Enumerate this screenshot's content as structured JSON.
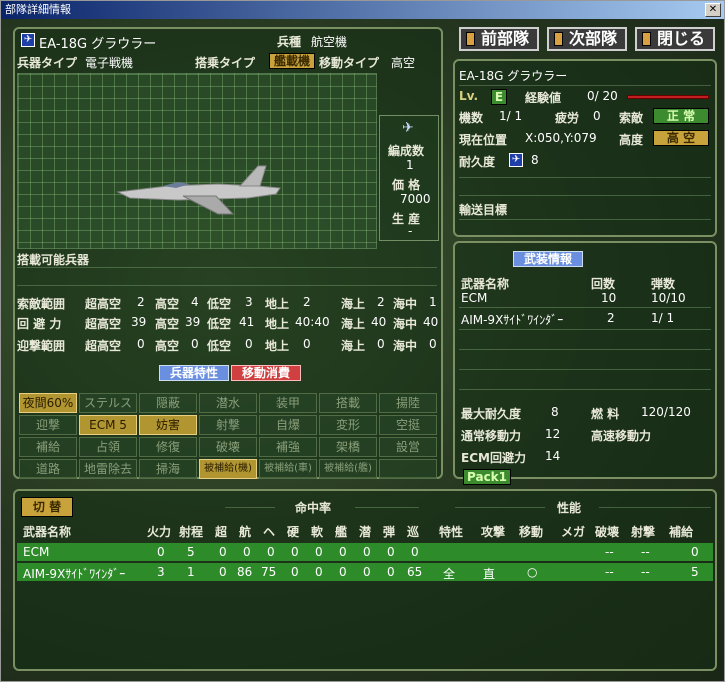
{
  "window": {
    "title": "部隊詳細情報",
    "close_label": "✕"
  },
  "left": {
    "unit_name": "EA-18G グラウラー",
    "type_label": "兵種",
    "type_value": "航空機",
    "weapon_type_label": "兵器タイプ",
    "weapon_type_value": "電子戦機",
    "carry_type_label": "搭乗タイプ",
    "carry_type_value": "艦載機",
    "move_type_label": "移動タイプ",
    "move_type_value": "高空",
    "formation_label": "編成数",
    "formation_value": "1",
    "price_label": "価 格",
    "price_value": "7000",
    "produce_label": "生 産",
    "produce_value": "-",
    "loadable_label": "搭載可能兵器",
    "ranges": [
      {
        "label": "索敵範囲",
        "vals": [
          "超高空",
          "2",
          "高空",
          "4",
          "低空",
          "3",
          "地上",
          "2",
          "海上",
          "2",
          "海中",
          "1"
        ]
      },
      {
        "label": "回 避 力",
        "vals": [
          "超高空",
          "39",
          "高空",
          "39",
          "低空",
          "41",
          "地上",
          "40:40",
          "海上",
          "40",
          "海中",
          "40"
        ]
      },
      {
        "label": "迎撃範囲",
        "vals": [
          "超高空",
          "0",
          "高空",
          "0",
          "低空",
          "0",
          "地上",
          "0",
          "海上",
          "0",
          "海中",
          "0"
        ]
      }
    ],
    "tab_skill": "兵器特性",
    "tab_move": "移動消費",
    "skills": [
      [
        "夜間60%",
        "ステルス",
        "隠蔽",
        "潜水",
        "装甲",
        "搭載",
        "揚陸"
      ],
      [
        "迎撃",
        "ECM 5",
        "妨害",
        "射撃",
        "自爆",
        "変形",
        "空挺"
      ],
      [
        "補給",
        "占領",
        "修復",
        "破壊",
        "補強",
        "架橋",
        "設営"
      ],
      [
        "道路",
        "地雷除去",
        "掃海",
        "被補給(機)",
        "被補給(車)",
        "被補給(艦)",
        ""
      ]
    ]
  },
  "nav": {
    "prev": "前部隊",
    "next": "次部隊",
    "close": "閉じる"
  },
  "status": {
    "unit_name": "EA-18G グラウラー",
    "lv_label": "Lv.",
    "lv_value": "E",
    "exp_label": "経験値",
    "exp_value": "0/ 20",
    "count_label": "機数",
    "count_value": "1/ 1",
    "fatigue_label": "疲労",
    "fatigue_value": "0",
    "search_label": "索敵",
    "search_value": "正 常",
    "pos_label": "現在位置",
    "pos_value": "X:050,Y:079",
    "alt_label": "高度",
    "alt_value": "高 空",
    "dur_label": "耐久度",
    "dur_value": "8",
    "transport_label": "輸送目標"
  },
  "arms": {
    "tab": "武装情報",
    "headers": [
      "武器名称",
      "回数",
      "弾数"
    ],
    "rows": [
      {
        "name": "ECM",
        "count": "10",
        "ammo": "10/10"
      },
      {
        "name": "AIM-9Xｻｲﾄﾞﾜｲﾝﾀﾞｰ",
        "count": "2",
        "ammo": "1/ 1"
      }
    ],
    "max_dur_label": "最大耐久度",
    "max_dur_value": "8",
    "fuel_label": "燃 料",
    "fuel_value": "120/120",
    "move_label": "通常移動力",
    "move_value": "12",
    "fast_move_label": "高速移動力",
    "ecm_label": "ECM回避力",
    "ecm_value": "14",
    "pack_label": "Pack1"
  },
  "bottom": {
    "switch_label": "切 替",
    "hit_label": "命中率",
    "perf_label": "性能",
    "headers": [
      "武器名称",
      "火力",
      "射程",
      "超",
      "航",
      "ヘ",
      "硬",
      "軟",
      "艦",
      "潜",
      "弾",
      "巡",
      "特性",
      "攻撃",
      "移動",
      "メガ",
      "破壊",
      "射撃",
      "補給"
    ],
    "rows": [
      [
        "ECM",
        "0",
        "5",
        "0",
        "0",
        "0",
        "0",
        "0",
        "0",
        "0",
        "0",
        "0",
        "",
        "",
        "",
        "",
        "--",
        "--",
        "0"
      ],
      [
        "AIM-9Xｻｲﾄﾞﾜｲﾝﾀﾞｰ",
        "3",
        "1",
        "0",
        "86",
        "75",
        "0",
        "0",
        "0",
        "0",
        "0",
        "65",
        "全",
        "直",
        "○",
        "",
        "--",
        "--",
        "5"
      ]
    ]
  }
}
